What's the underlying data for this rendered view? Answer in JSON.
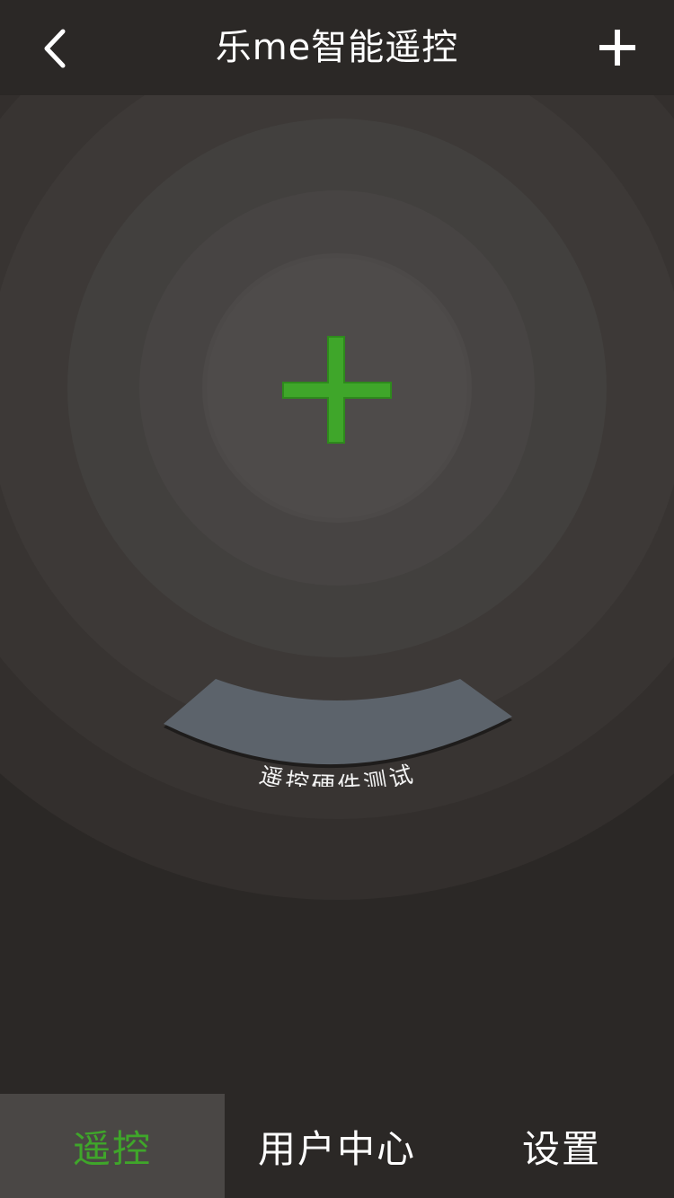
{
  "header": {
    "title": "乐me智能遥控",
    "back_icon": "chevron-left-icon",
    "add_icon": "plus-icon"
  },
  "main": {
    "center_icon": "plus-icon",
    "hardware_test_label": "遥控硬件测试"
  },
  "tabbar": {
    "tabs": [
      {
        "label": "遥控",
        "active": true
      },
      {
        "label": "用户中心",
        "active": false
      },
      {
        "label": "设置",
        "active": false
      }
    ]
  },
  "colors": {
    "accent": "#3fa62a",
    "background": "#2b2826",
    "hardware_badge": "#5c636b",
    "active_tab_bg": "#4a4745"
  }
}
